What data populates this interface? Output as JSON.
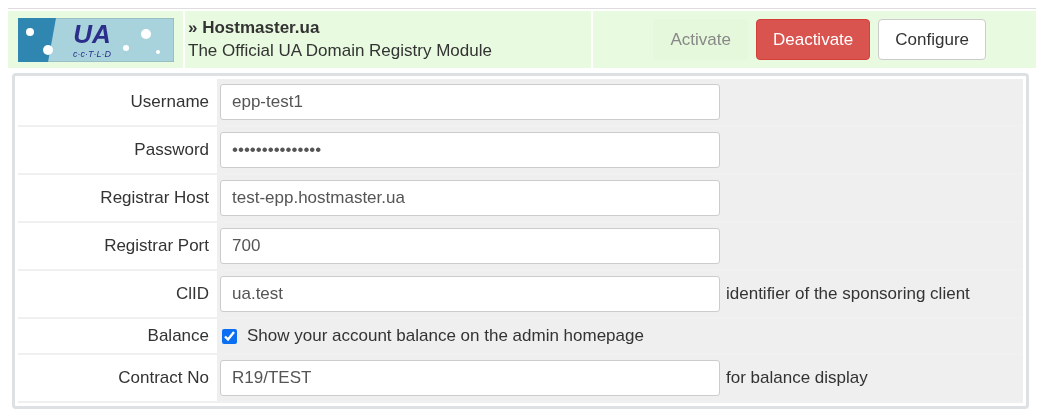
{
  "module": {
    "logo": {
      "text": "UA",
      "subtext": "c·c·T·L·D"
    },
    "title": "» Hostmaster.ua",
    "description": "The Official UA Domain Registry Module",
    "actions": [
      {
        "label": "Activate",
        "kind": "disabled"
      },
      {
        "label": "Deactivate",
        "kind": "danger"
      },
      {
        "label": "Configure",
        "kind": "default"
      }
    ]
  },
  "settings": [
    {
      "label": "Username",
      "kind": "text",
      "value": "epp-test1"
    },
    {
      "label": "Password",
      "kind": "text",
      "value": "•••••••••••••••"
    },
    {
      "label": "Registrar Host",
      "kind": "text",
      "value": "test-epp.hostmaster.ua"
    },
    {
      "label": "Registrar Port",
      "kind": "text",
      "value": "700"
    },
    {
      "label": "ClID",
      "kind": "text",
      "value": "ua.test",
      "hint": "identifier of the sponsoring client"
    },
    {
      "label": "Balance",
      "kind": "checkbox",
      "checked": true,
      "hint": "Show your account balance on the admin homepage"
    },
    {
      "label": "Contract No",
      "kind": "text",
      "value": "R19/TEST",
      "hint": "for balance display"
    }
  ]
}
